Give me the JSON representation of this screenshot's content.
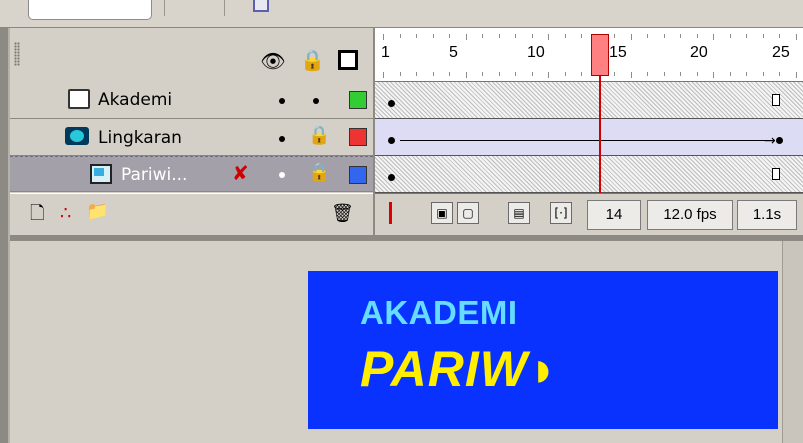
{
  "timeline": {
    "frame_numbers": [
      "1",
      "5",
      "10",
      "15",
      "20",
      "25"
    ],
    "current_frame": "14",
    "fps": "12.0 fps",
    "elapsed": "1.1s"
  },
  "header_icons": [
    "eye-icon",
    "lock-icon",
    "outline-icon"
  ],
  "layers": [
    {
      "name": "Akademi",
      "type": "normal",
      "color": "#33cc33",
      "selected": false
    },
    {
      "name": "Lingkaran",
      "type": "motion-guide",
      "color": "#ee3333",
      "selected": false
    },
    {
      "name": "Pariwi...",
      "type": "guided",
      "color": "#3366ee",
      "selected": true
    }
  ],
  "stage": {
    "background": "#0a32ff",
    "text_line1": "AKADEMI",
    "text_line2": "PARIW◗"
  }
}
